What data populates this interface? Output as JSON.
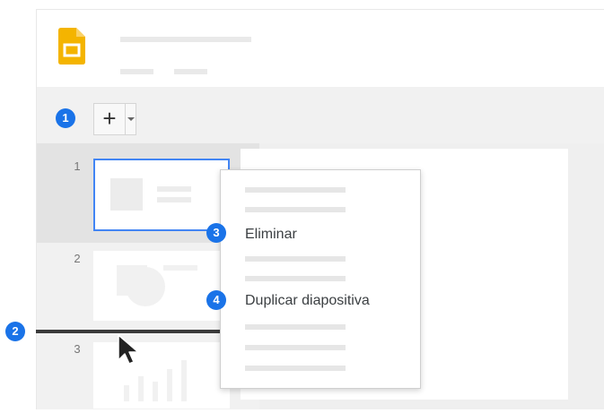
{
  "toolbar": {
    "add_label": "+"
  },
  "filmstrip": {
    "slides": [
      {
        "number": "1",
        "selected": true
      },
      {
        "number": "2",
        "selected": false
      },
      {
        "number": "3",
        "selected": false
      }
    ]
  },
  "context_menu": {
    "items": [
      {
        "label": "Eliminar",
        "badge": "3"
      },
      {
        "label": "Duplicar diapositiva",
        "badge": "4"
      }
    ]
  },
  "callouts": {
    "new_slide": "1",
    "drop_position": "2"
  },
  "colors": {
    "accent": "#1a73e8",
    "selection": "#4285f4",
    "logo": "#f4b400"
  }
}
